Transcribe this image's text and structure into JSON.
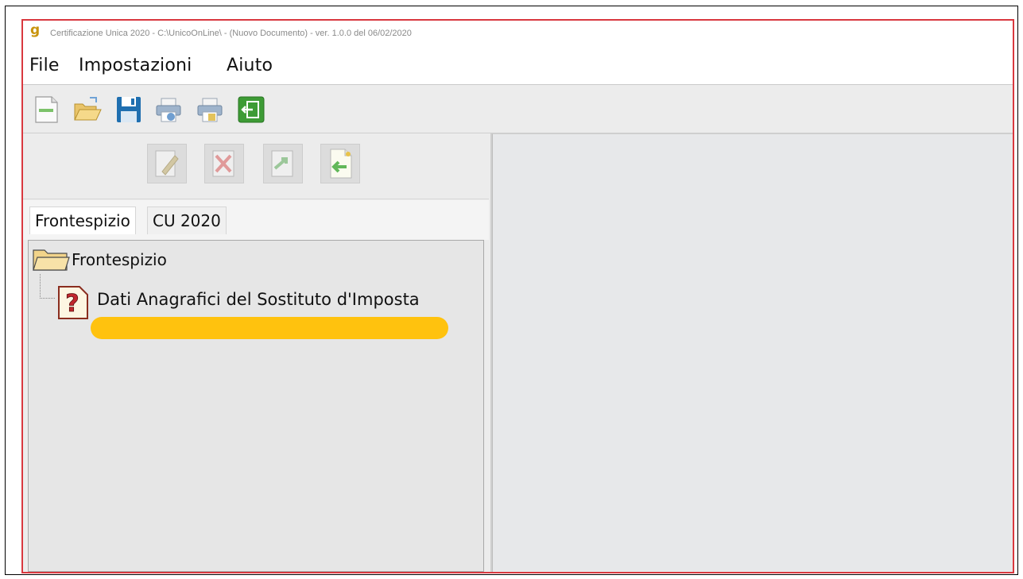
{
  "window": {
    "title": "Certificazione Unica 2020 - C:\\UnicoOnLine\\ - (Nuovo Documento)  -  ver. 1.0.0 del 06/02/2020",
    "accent_border": "#d9383f"
  },
  "menu": {
    "file": "File",
    "impostazioni": "Impostazioni",
    "aiuto": "Aiuto"
  },
  "toolbar": {
    "icons": [
      "new-document-icon",
      "open-folder-icon",
      "save-icon",
      "print-icon",
      "print-preview-icon",
      "exit-icon"
    ]
  },
  "sub_toolbar": {
    "icons": [
      "edit-icon",
      "delete-icon",
      "export-icon",
      "add-document-icon"
    ]
  },
  "tabs": [
    {
      "label": "Frontespizio",
      "active": true
    },
    {
      "label": "CU 2020",
      "active": false
    }
  ],
  "tree": {
    "root": {
      "label": "Frontespizio",
      "icon": "folder-icon"
    },
    "children": [
      {
        "label": "Dati Anagrafici del Sostituto d'Imposta",
        "icon": "question-icon"
      }
    ],
    "highlight_color": "#ffc20e"
  }
}
